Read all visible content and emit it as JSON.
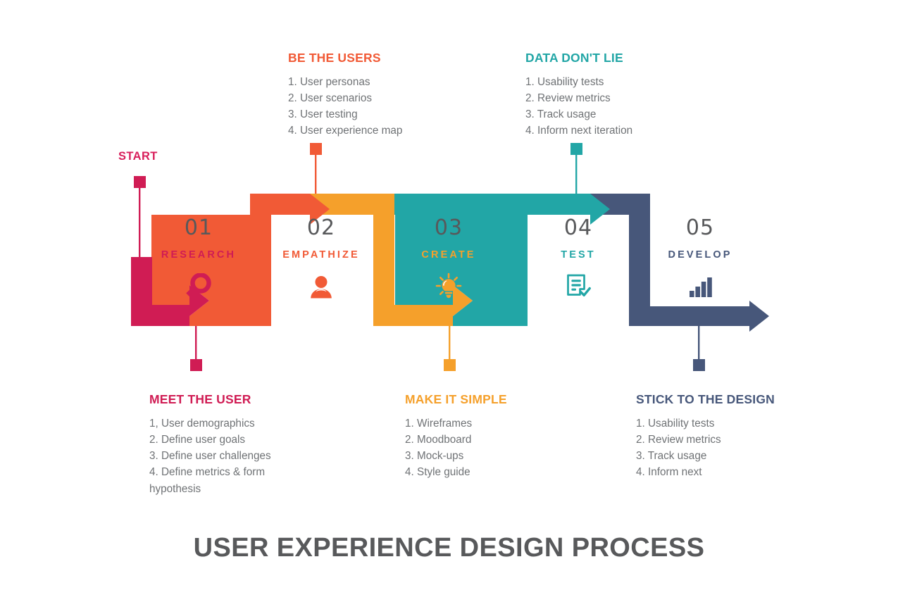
{
  "title": "USER EXPERIENCE DESIGN PROCESS",
  "start_label": "START",
  "colors": {
    "step1": "#D01C54",
    "step2": "#F15A36",
    "step3": "#F5A02B",
    "step4": "#22A6A6",
    "step5": "#47577A",
    "number": "#58595b",
    "body_text": "#6f7275",
    "title": "#58595b"
  },
  "steps": [
    {
      "num": "01",
      "label": "RESEARCH",
      "icon": "magnifier-icon",
      "color": "#D01C54"
    },
    {
      "num": "02",
      "label": "EMPATHIZE",
      "icon": "user-icon",
      "color": "#F15A36"
    },
    {
      "num": "03",
      "label": "CREATE",
      "icon": "lightbulb-icon",
      "color": "#F5A02B"
    },
    {
      "num": "04",
      "label": "TEST",
      "icon": "checklist-icon",
      "color": "#22A6A6"
    },
    {
      "num": "05",
      "label": "DEVELOP",
      "icon": "bar-chart-icon",
      "color": "#47577A"
    }
  ],
  "callouts": [
    {
      "id": "be-the-users",
      "title": "BE THE USERS",
      "color": "#F15A36",
      "items": [
        "1. User personas",
        "2. User scenarios",
        "3. User testing",
        "4. User experience map"
      ]
    },
    {
      "id": "data-dont-lie",
      "title": "DATA DON'T LIE",
      "color": "#22A6A6",
      "items": [
        "1. Usability tests",
        "2. Review metrics",
        "3. Track usage",
        "4. Inform next iteration"
      ]
    },
    {
      "id": "meet-the-user",
      "title": "MEET THE USER",
      "color": "#D01C54",
      "items": [
        "1, User demographics",
        "2. Define user goals",
        "3. Define user challenges",
        "4. Define metrics & form\nhypothesis"
      ]
    },
    {
      "id": "make-it-simple",
      "title": "MAKE  IT SIMPLE",
      "color": "#F5A02B",
      "items": [
        "1. Wireframes",
        "2. Moodboard",
        "3. Mock-ups",
        "4. Style guide"
      ]
    },
    {
      "id": "stick-to-the-design",
      "title": "STICK TO THE DESIGN",
      "color": "#47577A",
      "items": [
        "1. Usability tests",
        "2. Review metrics",
        "3. Track usage",
        "4. Inform next"
      ]
    }
  ]
}
